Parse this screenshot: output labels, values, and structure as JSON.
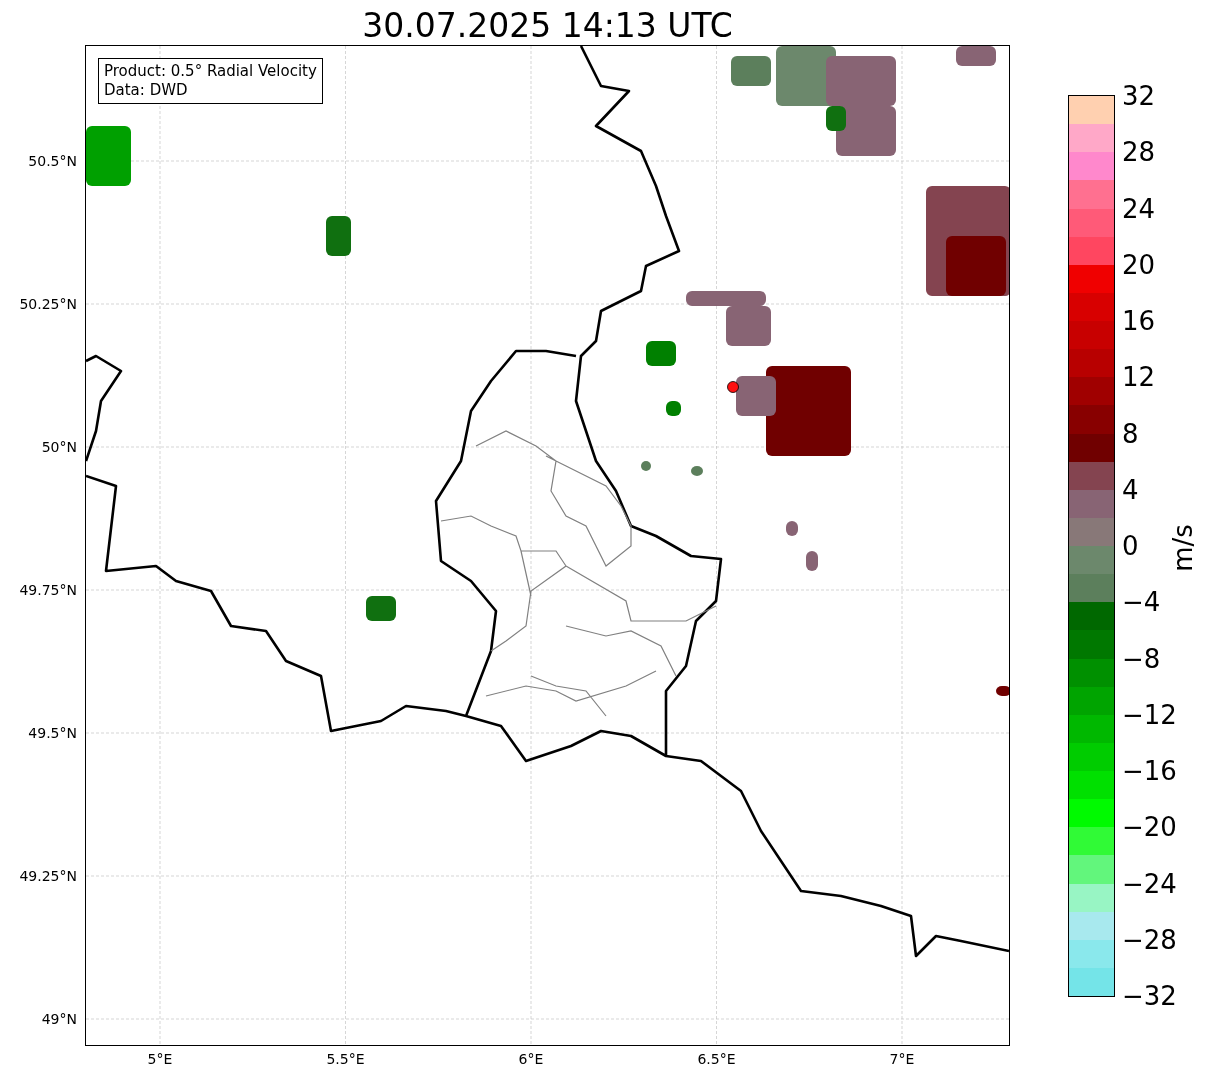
{
  "title": "30.07.2025 14:13 UTC",
  "map": {
    "xticks": [
      "5°E",
      "5.5°E",
      "6°E",
      "6.5°E",
      "7°E"
    ],
    "yticks": [
      "50.5°N",
      "50.25°N",
      "50°N",
      "49.75°N",
      "49.5°N",
      "49.25°N",
      "49°N"
    ],
    "legend": [
      "Product: 0.5° Radial Velocity",
      "Data: DWD"
    ]
  },
  "colorbar": {
    "label": "m/s",
    "ticks": [
      "32",
      "28",
      "24",
      "20",
      "16",
      "12",
      "8",
      "4",
      "0",
      "−4",
      "−8",
      "−12",
      "−16",
      "−20",
      "−24",
      "−28",
      "−32"
    ],
    "bands": [
      {
        "color": "#ffd0b0"
      },
      {
        "color": "#ffa8c8"
      },
      {
        "color": "#ff88cc"
      },
      {
        "color": "#ff7090"
      },
      {
        "color": "#ff5a78"
      },
      {
        "color": "#ff4660"
      },
      {
        "color": "#f00000"
      },
      {
        "color": "#d80000"
      },
      {
        "color": "#c80000"
      },
      {
        "color": "#b80000"
      },
      {
        "color": "#a00000"
      },
      {
        "color": "#880000"
      },
      {
        "color": "#700000"
      },
      {
        "color": "#844450"
      },
      {
        "color": "#886474"
      },
      {
        "color": "#887878"
      },
      {
        "color": "#6c886c"
      },
      {
        "color": "#5c7f5c"
      },
      {
        "color": "#006800"
      },
      {
        "color": "#007800"
      },
      {
        "color": "#009000"
      },
      {
        "color": "#00a400"
      },
      {
        "color": "#00b800"
      },
      {
        "color": "#00cc00"
      },
      {
        "color": "#00e000"
      },
      {
        "color": "#00fa00"
      },
      {
        "color": "#30fa36"
      },
      {
        "color": "#62f67c"
      },
      {
        "color": "#98f5c4"
      },
      {
        "color": "#a8e9ee"
      },
      {
        "color": "#8ae8ec"
      },
      {
        "color": "#74e4e8"
      }
    ]
  }
}
